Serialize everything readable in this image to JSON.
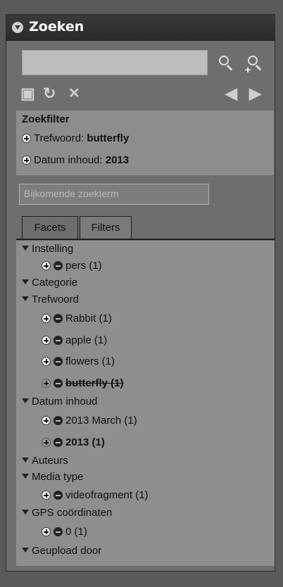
{
  "panel": {
    "title": "Zoeken"
  },
  "search": {
    "value": "",
    "placeholder_extra": "Bijkomende zoekterm"
  },
  "filter": {
    "title": "Zoekfilter",
    "items": [
      {
        "label": "Trefwoord: ",
        "value": "butterfly"
      },
      {
        "label": "Datum inhoud: ",
        "value": "2013"
      }
    ]
  },
  "tabs": [
    "Facets",
    "Filters"
  ],
  "tree": {
    "groups": [
      {
        "label": "Instelling",
        "items": [
          "pers (1)"
        ]
      },
      {
        "label": "Categorie",
        "items": []
      },
      {
        "label": "Trefwoord",
        "items": [
          "Rabbit (1)",
          "apple (1)",
          "flowers (1)",
          "butterfly (1)"
        ]
      },
      {
        "label": "Datum inhoud",
        "items": [
          "2013 March (1)",
          "2013 (1)"
        ]
      },
      {
        "label": "Auteurs",
        "items": []
      },
      {
        "label": "Media type",
        "items": [
          "videofragment (1)"
        ]
      },
      {
        "label": "GPS coördinaten",
        "items": [
          "0 (1)"
        ]
      },
      {
        "label": "Geupload door",
        "items": []
      }
    ]
  },
  "icons": {
    "header": "collapse-icon",
    "search": "search-icon",
    "add_search": "add-search-icon",
    "save": "save-icon",
    "refresh": "refresh-icon",
    "clear": "clear-icon",
    "prev": "previous-icon",
    "next": "next-icon"
  }
}
